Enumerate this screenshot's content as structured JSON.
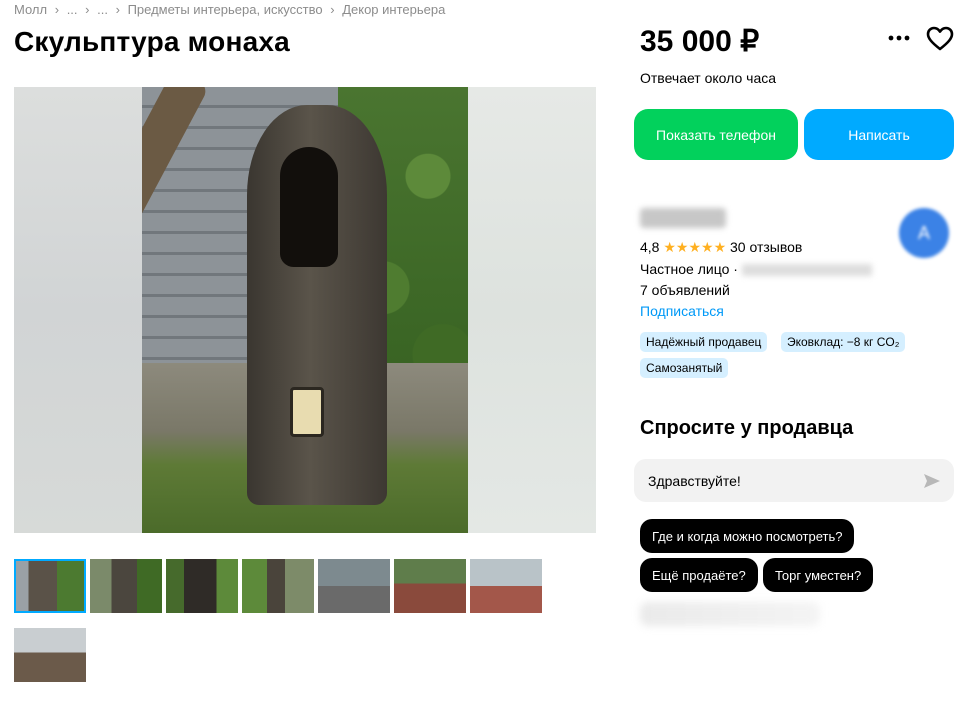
{
  "breadcrumb": [
    "Молл",
    "›",
    "...",
    "›",
    "...",
    "›",
    "Предметы интерьера, искусство",
    "›",
    "Декор интерьера"
  ],
  "title": "Скульптура монаха",
  "price": "35 000 ₽",
  "response_time": "Отвечает около часа",
  "buttons": {
    "show_phone": "Показать телефон",
    "write": "Написать"
  },
  "seller": {
    "avatar_letter": "А",
    "rating": "4,8",
    "stars": "★★★★★",
    "reviews": "30 отзывов",
    "type": "Частное лицо ·",
    "ads": "7 объявлений",
    "subscribe": "Подписаться",
    "badges": [
      "Надёжный продавец",
      "Эковклад: −8 кг CO₂",
      "Самозанятый"
    ]
  },
  "ask": {
    "title": "Спросите у продавца",
    "input_value": "Здравствуйте!",
    "quick_questions": [
      "Где и когда можно посмотреть?",
      "Ещё продаёте?",
      "Торг уместен?"
    ]
  },
  "icons": {
    "more": "more-icon",
    "favorite": "heart-icon",
    "send": "send-icon"
  },
  "colors": {
    "green": "#02d15c",
    "blue": "#00aaff",
    "link": "#0099f7",
    "star": "#ffb021",
    "badge_bg": "#d5efff"
  },
  "thumbnails_count": 8
}
